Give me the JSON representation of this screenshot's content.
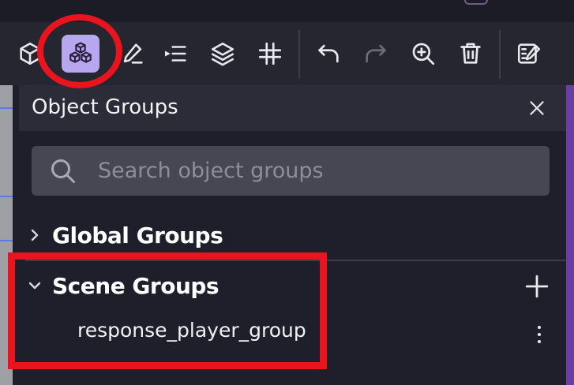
{
  "toolbar": {
    "tools": [
      {
        "name": "cube-icon",
        "active": false
      },
      {
        "name": "object-groups-icon",
        "active": true
      },
      {
        "name": "edit-icon",
        "active": false
      },
      {
        "name": "list-icon",
        "active": false
      },
      {
        "name": "layers-icon",
        "active": false
      },
      {
        "name": "grid-icon",
        "active": false
      },
      {
        "name": "undo-icon",
        "active": false
      },
      {
        "name": "redo-icon",
        "active": false,
        "disabled": true
      },
      {
        "name": "zoom-icon",
        "active": false
      },
      {
        "name": "trash-icon",
        "active": false
      },
      {
        "name": "scene-properties-icon",
        "active": false
      }
    ]
  },
  "panel": {
    "title": "Object Groups",
    "close_icon": "close-icon",
    "search": {
      "placeholder": "Search object groups",
      "value": ""
    },
    "groups": [
      {
        "label": "Global Groups",
        "expanded": false
      },
      {
        "label": "Scene Groups",
        "expanded": true,
        "items": [
          "response_player_group"
        ]
      }
    ]
  },
  "colors": {
    "accent": "#b7a7ef",
    "annotation": "#e8141e",
    "panel_bg": "#1e1f2a",
    "header_bg": "#2b2c38",
    "search_bg": "#464752"
  }
}
